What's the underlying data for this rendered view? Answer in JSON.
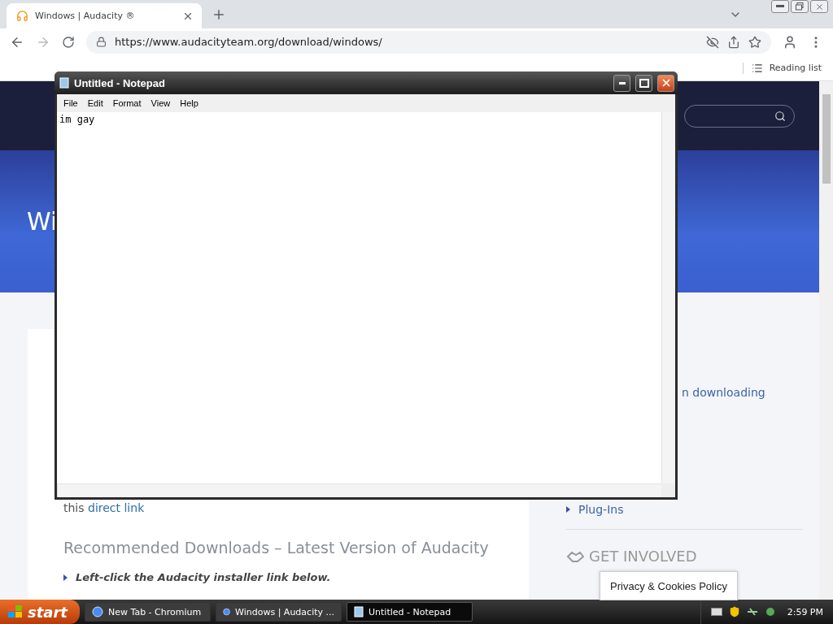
{
  "browser": {
    "tabs": [
      {
        "title": "Windows | Audacity ®",
        "selected": true
      }
    ],
    "url": "https://www.audacityteam.org/download/windows/",
    "reading_list": "Reading list"
  },
  "website": {
    "banner_heading": "Wi",
    "sidebar_partial": "n downloading",
    "text_before_link": "this",
    "link": "direct link",
    "heading": "Recommended Downloads – Latest Version of Audacity",
    "bullet": "Left-click the Audacity installer link below.",
    "sidebar_link": "Plug-Ins",
    "section_title": "GET INVOLVED"
  },
  "notepad": {
    "title": "Untitled - Notepad",
    "menu": [
      "File",
      "Edit",
      "Format",
      "View",
      "Help"
    ],
    "text": "im gay"
  },
  "cookie_notice": "Privacy & Cookies Policy",
  "taskbar": {
    "start": "start",
    "tasks": [
      {
        "label": "New Tab - Chromium",
        "kind": "browser",
        "selected": false
      },
      {
        "label": "Windows | Audacity ...",
        "kind": "browser",
        "selected": false
      },
      {
        "label": "Untitled - Notepad",
        "kind": "notepad",
        "selected": true
      }
    ],
    "clock": "2:59 PM"
  }
}
